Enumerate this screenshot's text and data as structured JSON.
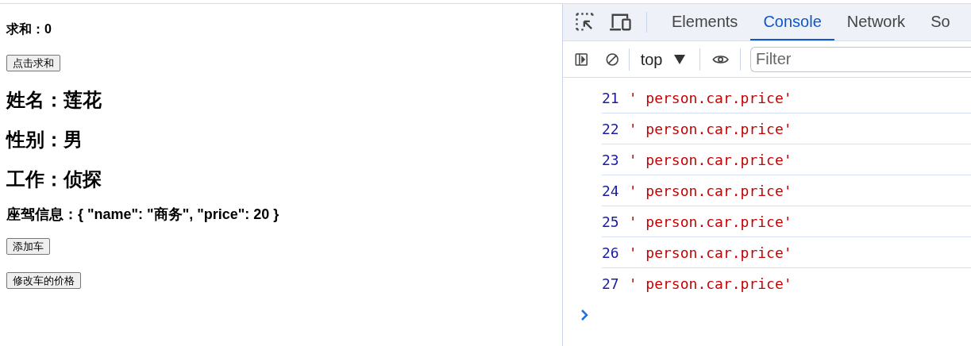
{
  "page": {
    "sum_label": "求和：0",
    "sum_button": "点击求和",
    "name": "姓名：莲花",
    "gender": "性别：男",
    "job": "工作：侦探",
    "car_info": "座驾信息：{ \"name\": \"商务\", \"price\": 20 }",
    "add_car_button": "添加车",
    "change_price_button": "修改车的价格"
  },
  "devtools": {
    "tabs": [
      {
        "label": "Elements",
        "selected": false
      },
      {
        "label": "Console",
        "selected": true
      },
      {
        "label": "Network",
        "selected": false
      },
      {
        "label": "So",
        "selected": false
      }
    ],
    "context": "top",
    "filter": {
      "placeholder": "Filter"
    },
    "messages": [
      {
        "count": "21",
        "text": "' person.car.price'"
      },
      {
        "count": "22",
        "text": "' person.car.price'"
      },
      {
        "count": "23",
        "text": "' person.car.price'"
      },
      {
        "count": "24",
        "text": "' person.car.price'"
      },
      {
        "count": "25",
        "text": "' person.car.price'"
      },
      {
        "count": "26",
        "text": "' person.car.price'"
      },
      {
        "count": "27",
        "text": "' person.car.price'"
      }
    ]
  }
}
